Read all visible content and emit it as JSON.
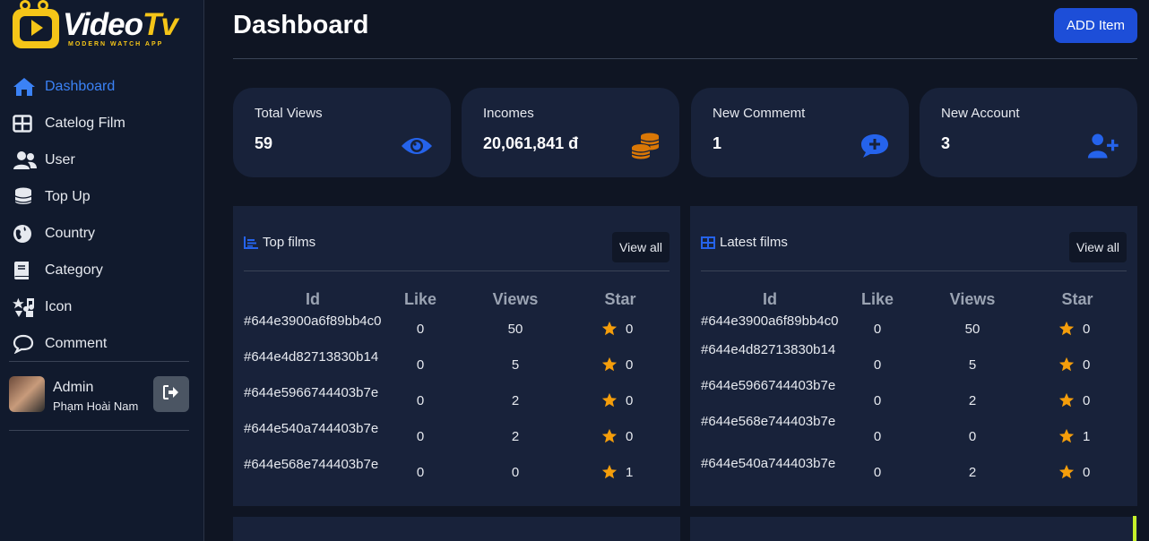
{
  "brand": {
    "name_main": "Video",
    "name_accent": "Tv",
    "tagline": "MODERN WATCH APP"
  },
  "sidebar": {
    "items": [
      {
        "label": "Dashboard",
        "icon": "home-icon",
        "active": true
      },
      {
        "label": "Catelog Film",
        "icon": "grid-icon"
      },
      {
        "label": "User",
        "icon": "users-icon"
      },
      {
        "label": "Top Up",
        "icon": "coins-icon"
      },
      {
        "label": "Country",
        "icon": "globe-icon"
      },
      {
        "label": "Category",
        "icon": "book-icon"
      },
      {
        "label": "Icon",
        "icon": "icons-icon"
      },
      {
        "label": "Comment",
        "icon": "comment-icon"
      }
    ],
    "admin": {
      "name": "Admin",
      "fullname": "Phạm Hoài Nam"
    }
  },
  "header": {
    "title": "Dashboard",
    "add_button": "ADD Item"
  },
  "stats": [
    {
      "label": "Total Views",
      "value": "59",
      "icon": "eye-icon",
      "color": "#2563eb"
    },
    {
      "label": "Incomes",
      "value": "20,061,841 đ",
      "icon": "coins-icon",
      "color": "#d97706"
    },
    {
      "label": "New Commemt",
      "value": "1",
      "icon": "comment-plus-icon",
      "color": "#2563eb"
    },
    {
      "label": "New Account",
      "value": "3",
      "icon": "user-plus-icon",
      "color": "#2563eb"
    }
  ],
  "top_films": {
    "title": "Top films",
    "view_all": "View all",
    "columns": [
      "Id",
      "Like",
      "Views",
      "Star"
    ],
    "rows": [
      {
        "id": "#644e3900a6f89bb4c0",
        "like": "0",
        "views": "50",
        "star": "0"
      },
      {
        "id": "#644e4d82713830b14",
        "like": "0",
        "views": "5",
        "star": "0"
      },
      {
        "id": "#644e5966744403b7e",
        "like": "0",
        "views": "2",
        "star": "0"
      },
      {
        "id": "#644e540a744403b7e",
        "like": "0",
        "views": "2",
        "star": "0"
      },
      {
        "id": "#644e568e744403b7e",
        "like": "0",
        "views": "0",
        "star": "1"
      }
    ]
  },
  "latest_films": {
    "title": "Latest films",
    "view_all": "View all",
    "columns": [
      "Id",
      "Like",
      "Views",
      "Star"
    ],
    "rows": [
      {
        "id": "#644e3900a6f89bb4c0",
        "like": "0",
        "views": "50",
        "star": "0"
      },
      {
        "id": "#644e4d82713830b14",
        "like": "0",
        "views": "5",
        "star": "0"
      },
      {
        "id": "#644e5966744403b7e",
        "like": "0",
        "views": "2",
        "star": "0"
      },
      {
        "id": "#644e568e744403b7e",
        "like": "0",
        "views": "0",
        "star": "1"
      },
      {
        "id": "#644e540a744403b7e",
        "like": "0",
        "views": "2",
        "star": "0"
      }
    ]
  },
  "colors": {
    "accent": "#2563eb",
    "star": "#f59e0b",
    "coin": "#d97706",
    "logo": "#f5c518"
  }
}
